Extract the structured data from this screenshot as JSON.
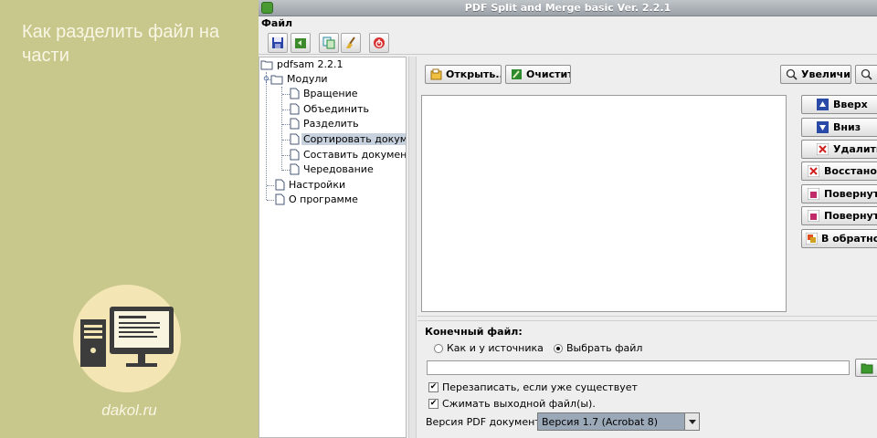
{
  "promo": {
    "title": "Как разделить файл на части",
    "site": "dakol.ru"
  },
  "window": {
    "title": "PDF Split and Merge basic Ver. 2.2.1"
  },
  "menu": {
    "file": "Файл"
  },
  "toolbar": {
    "icons": [
      "save-icon",
      "load-icon",
      "copy-icon",
      "clean-icon",
      "exit-icon"
    ]
  },
  "tree": {
    "root": "pdfsam 2.2.1",
    "modules": "Модули",
    "items": [
      "Вращение",
      "Объединить",
      "Разделить",
      "Сортировать документ",
      "Составить документ",
      "Чередование"
    ],
    "settings": "Настройки",
    "about": "О программе",
    "selected": "Сортировать документ"
  },
  "main": {
    "open": "Открыть...",
    "clear": "Очистить",
    "zoom_in": "Увеличить",
    "side_buttons": [
      "Вверх",
      "Вниз",
      "Удалить",
      "Восстановить",
      "Повернуть",
      "Повернуть",
      "В обратном"
    ]
  },
  "output": {
    "section_label": "Конечный файл:",
    "radio_same": "Как и у источника",
    "radio_choose": "Выбрать файл",
    "selected_radio": "Выбрать файл",
    "path_value": "",
    "overwrite": "Перезаписать, если уже существует",
    "compress": "Сжимать выходной файл(ы).",
    "version_label": "Версия PDF документа:",
    "version_value": "Версия 1.7 (Acrobat 8)"
  },
  "colors": {
    "promo_bg": "#c8c88c",
    "selection": "#c8d2de"
  }
}
